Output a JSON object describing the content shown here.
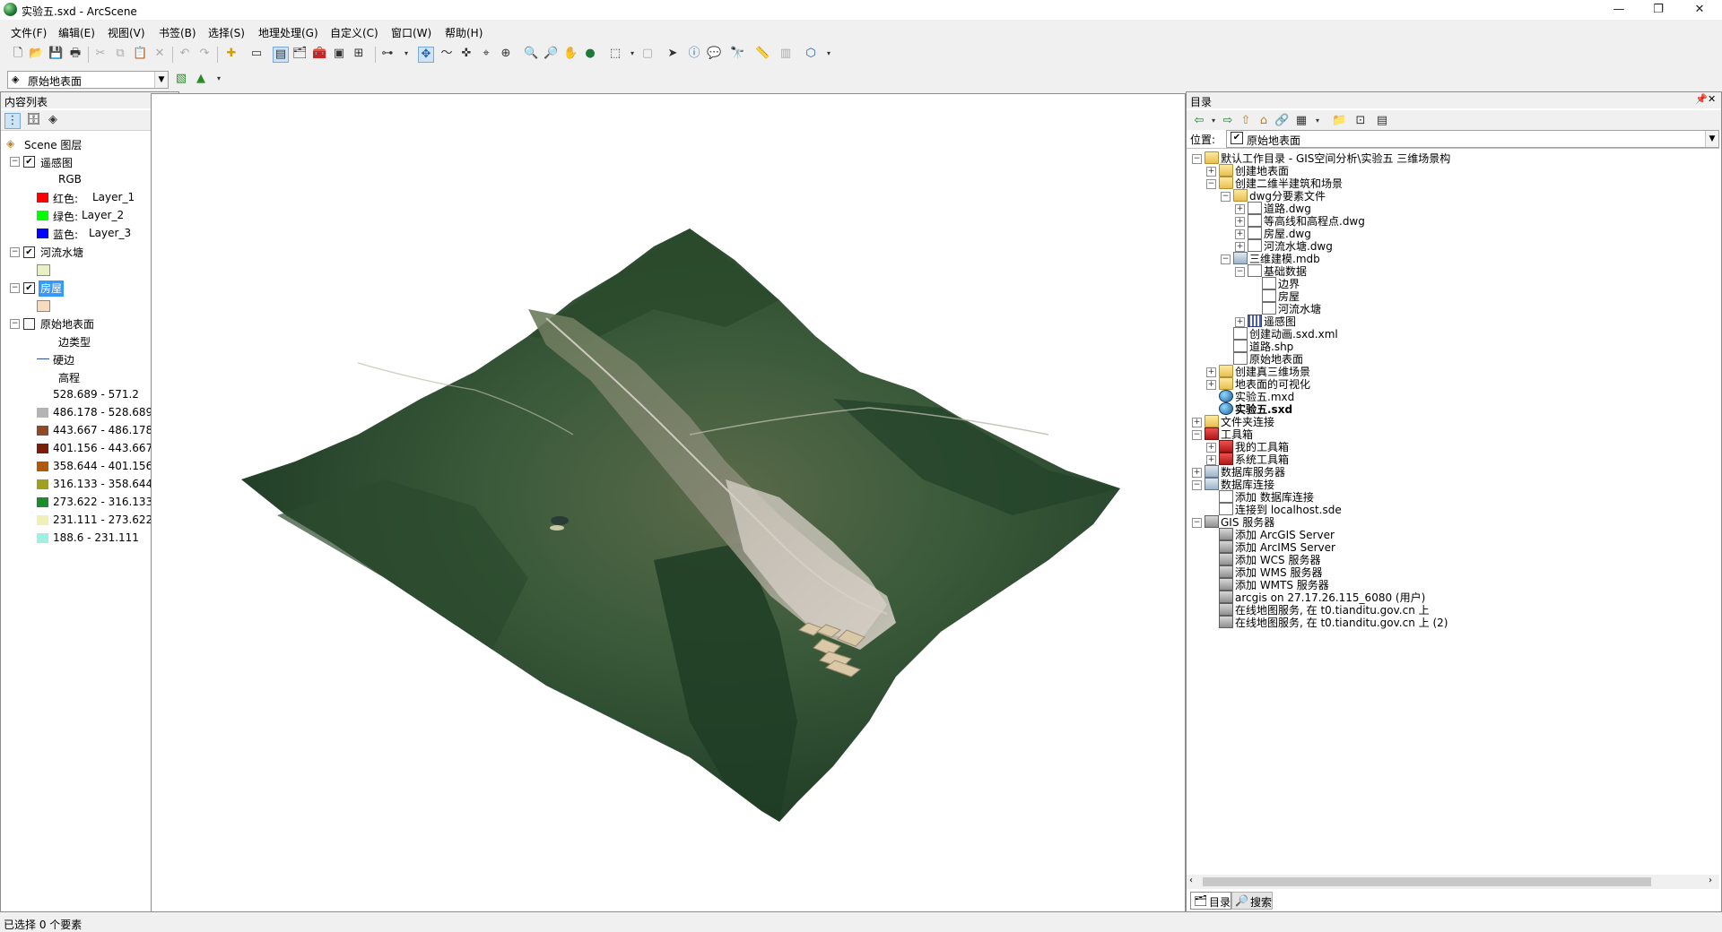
{
  "window": {
    "title": "实验五.sxd - ArcScene",
    "minimize": "—",
    "restore": "❐",
    "close": "✕"
  },
  "menu": [
    "文件(F)",
    "编辑(E)",
    "视图(V)",
    "书签(B)",
    "选择(S)",
    "地理处理(G)",
    "自定义(C)",
    "窗口(W)",
    "帮助(H)"
  ],
  "layer_combo": {
    "value": "原始地表面"
  },
  "toc": {
    "title": "内容列表",
    "root": "Scene 图层",
    "layers": {
      "rs": {
        "name": "遥感图",
        "rgb": "RGB",
        "bands": [
          {
            "label": "红色:",
            "value": "Layer_1",
            "color": "#ff0000"
          },
          {
            "label": "绿色:",
            "value": "Layer_2",
            "color": "#00ff00"
          },
          {
            "label": "蓝色:",
            "value": "Layer_3",
            "color": "#0000ff"
          }
        ]
      },
      "river": {
        "name": "河流水塘",
        "color": "#e8f0c8"
      },
      "house": {
        "name": "房屋",
        "color": "#f5dcc0"
      },
      "surface": {
        "name": "原始地表面",
        "edge_type": "边类型",
        "edge": "硬边",
        "elev": "高程",
        "classes": [
          {
            "label": "528.689 - 571.2",
            "color": "#ffffff"
          },
          {
            "label": "486.178 - 528.689",
            "color": "#b4b4b4"
          },
          {
            "label": "443.667 - 486.178",
            "color": "#8c4a28"
          },
          {
            "label": "401.156 - 443.667",
            "color": "#7a1e0a"
          },
          {
            "label": "358.644 - 401.156",
            "color": "#b05a0a"
          },
          {
            "label": "316.133 - 358.644",
            "color": "#a0a020"
          },
          {
            "label": "273.622 - 316.133",
            "color": "#1e8c2e"
          },
          {
            "label": "231.111 - 273.622",
            "color": "#f0f0b4"
          },
          {
            "label": "188.6 - 231.111",
            "color": "#a0f0e0"
          }
        ]
      }
    }
  },
  "catalog": {
    "title": "目录",
    "location_label": "位置:",
    "location_value": "原始地表面",
    "items": [
      {
        "text": "默认工作目录 - GIS空间分析\\实验五 三维场景构",
        "icon": "folder"
      },
      {
        "text": "创建地表面",
        "icon": "folder"
      },
      {
        "text": "创建二维半建筑和场景",
        "icon": "folder"
      },
      {
        "text": "dwg分要素文件",
        "icon": "folder"
      },
      {
        "text": "道路.dwg",
        "icon": "file"
      },
      {
        "text": "等高线和高程点.dwg",
        "icon": "file"
      },
      {
        "text": "房屋.dwg",
        "icon": "file"
      },
      {
        "text": "河流水塘.dwg",
        "icon": "file"
      },
      {
        "text": "三维建模.mdb",
        "icon": "db"
      },
      {
        "text": "基础数据",
        "icon": "file"
      },
      {
        "text": "边界",
        "icon": "file"
      },
      {
        "text": "房屋",
        "icon": "file"
      },
      {
        "text": "河流水塘",
        "icon": "file"
      },
      {
        "text": "遥感图",
        "icon": "grid"
      },
      {
        "text": "创建动画.sxd.xml",
        "icon": "file"
      },
      {
        "text": "道路.shp",
        "icon": "file"
      },
      {
        "text": "原始地表面",
        "icon": "file"
      },
      {
        "text": "创建真三维场景",
        "icon": "folder"
      },
      {
        "text": "地表面的可视化",
        "icon": "folder"
      },
      {
        "text": "实验五.mxd",
        "icon": "globe"
      },
      {
        "text": "实验五.sxd",
        "icon": "globe"
      },
      {
        "text": "文件夹连接",
        "icon": "folder"
      },
      {
        "text": "工具箱",
        "icon": "toolbox"
      },
      {
        "text": "我的工具箱",
        "icon": "toolbox"
      },
      {
        "text": "系统工具箱",
        "icon": "toolbox"
      },
      {
        "text": "数据库服务器",
        "icon": "db"
      },
      {
        "text": "数据库连接",
        "icon": "db"
      },
      {
        "text": "添加 数据库连接",
        "icon": "file"
      },
      {
        "text": "连接到 localhost.sde",
        "icon": "file"
      },
      {
        "text": "GIS 服务器",
        "icon": "server"
      },
      {
        "text": "添加 ArcGIS Server",
        "icon": "server"
      },
      {
        "text": "添加 ArcIMS Server",
        "icon": "server"
      },
      {
        "text": "添加 WCS 服务器",
        "icon": "server"
      },
      {
        "text": "添加 WMS 服务器",
        "icon": "server"
      },
      {
        "text": "添加 WMTS 服务器",
        "icon": "server"
      },
      {
        "text": "arcgis on 27.17.26.115_6080 (用户)",
        "icon": "server"
      },
      {
        "text": "在线地图服务, 在 t0.tianditu.gov.cn 上",
        "icon": "server"
      },
      {
        "text": "在线地图服务, 在 t0.tianditu.gov.cn 上 (2)",
        "icon": "server"
      }
    ],
    "tabs": [
      "目录",
      "搜索"
    ]
  },
  "status": "已选择 0 个要素"
}
